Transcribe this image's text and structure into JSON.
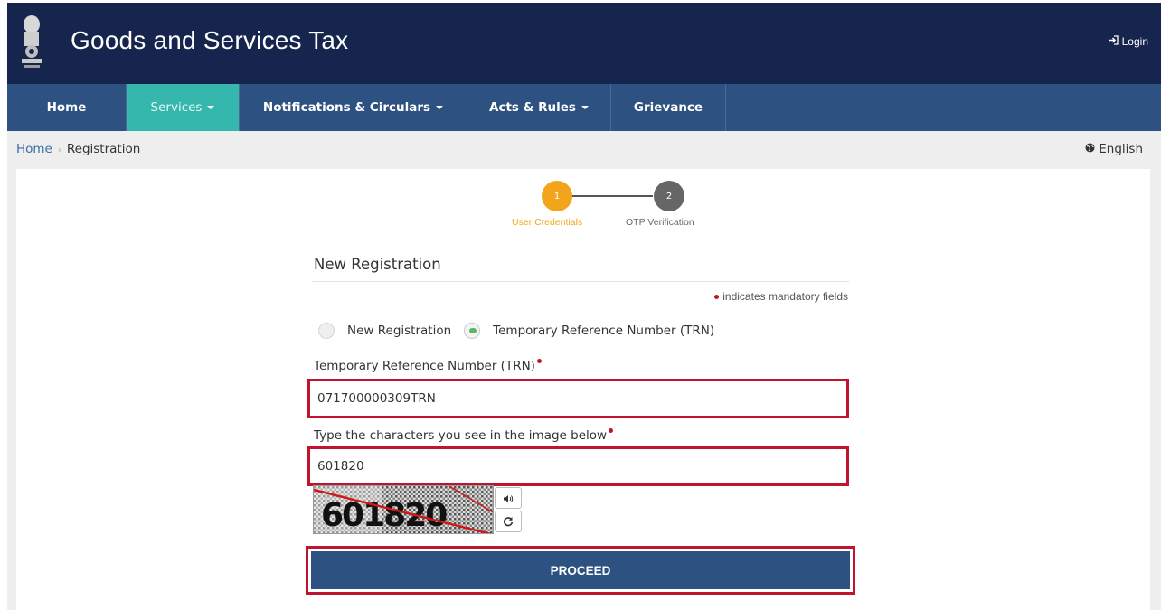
{
  "header": {
    "title": "Goods and Services Tax",
    "login_label": "Login"
  },
  "nav": {
    "items": [
      {
        "label": "Home",
        "dropdown": false,
        "active": false
      },
      {
        "label": "Services",
        "dropdown": true,
        "active": true
      },
      {
        "label": "Notifications & Circulars",
        "dropdown": true,
        "active": false
      },
      {
        "label": "Acts & Rules",
        "dropdown": true,
        "active": false
      },
      {
        "label": "Grievance",
        "dropdown": false,
        "active": false
      }
    ]
  },
  "breadcrumb": {
    "home": "Home",
    "current": "Registration"
  },
  "language": {
    "label": "English"
  },
  "stepper": {
    "steps": [
      {
        "number": "1",
        "label": "User Credentials",
        "state": "active",
        "color": "#f2a51c"
      },
      {
        "number": "2",
        "label": "OTP Verification",
        "state": "pending",
        "color": "#666666"
      }
    ]
  },
  "form": {
    "title": "New Registration",
    "mandatory_note": "indicates mandatory fields",
    "radio_options": [
      {
        "label": "New Registration",
        "checked": false
      },
      {
        "label": "Temporary Reference Number (TRN)",
        "checked": true
      }
    ],
    "trn_label": "Temporary Reference Number (TRN)",
    "trn_value": "071700000309TRN",
    "captcha_label": "Type the characters you see in the image below",
    "captcha_value": "601820",
    "captcha_image_text": "601820",
    "proceed_label": "PROCEED"
  },
  "colors": {
    "header_bg": "#16254d",
    "nav_bg": "#2d5181",
    "nav_active": "#35b7ae",
    "step_active": "#f2a51c",
    "highlight_border": "#c0142e",
    "required": "#c0142e"
  },
  "icons": {
    "login": "sign-in-icon",
    "language": "globe-icon",
    "audio": "speaker-icon",
    "refresh": "refresh-icon",
    "emblem": "national-emblem-icon"
  }
}
